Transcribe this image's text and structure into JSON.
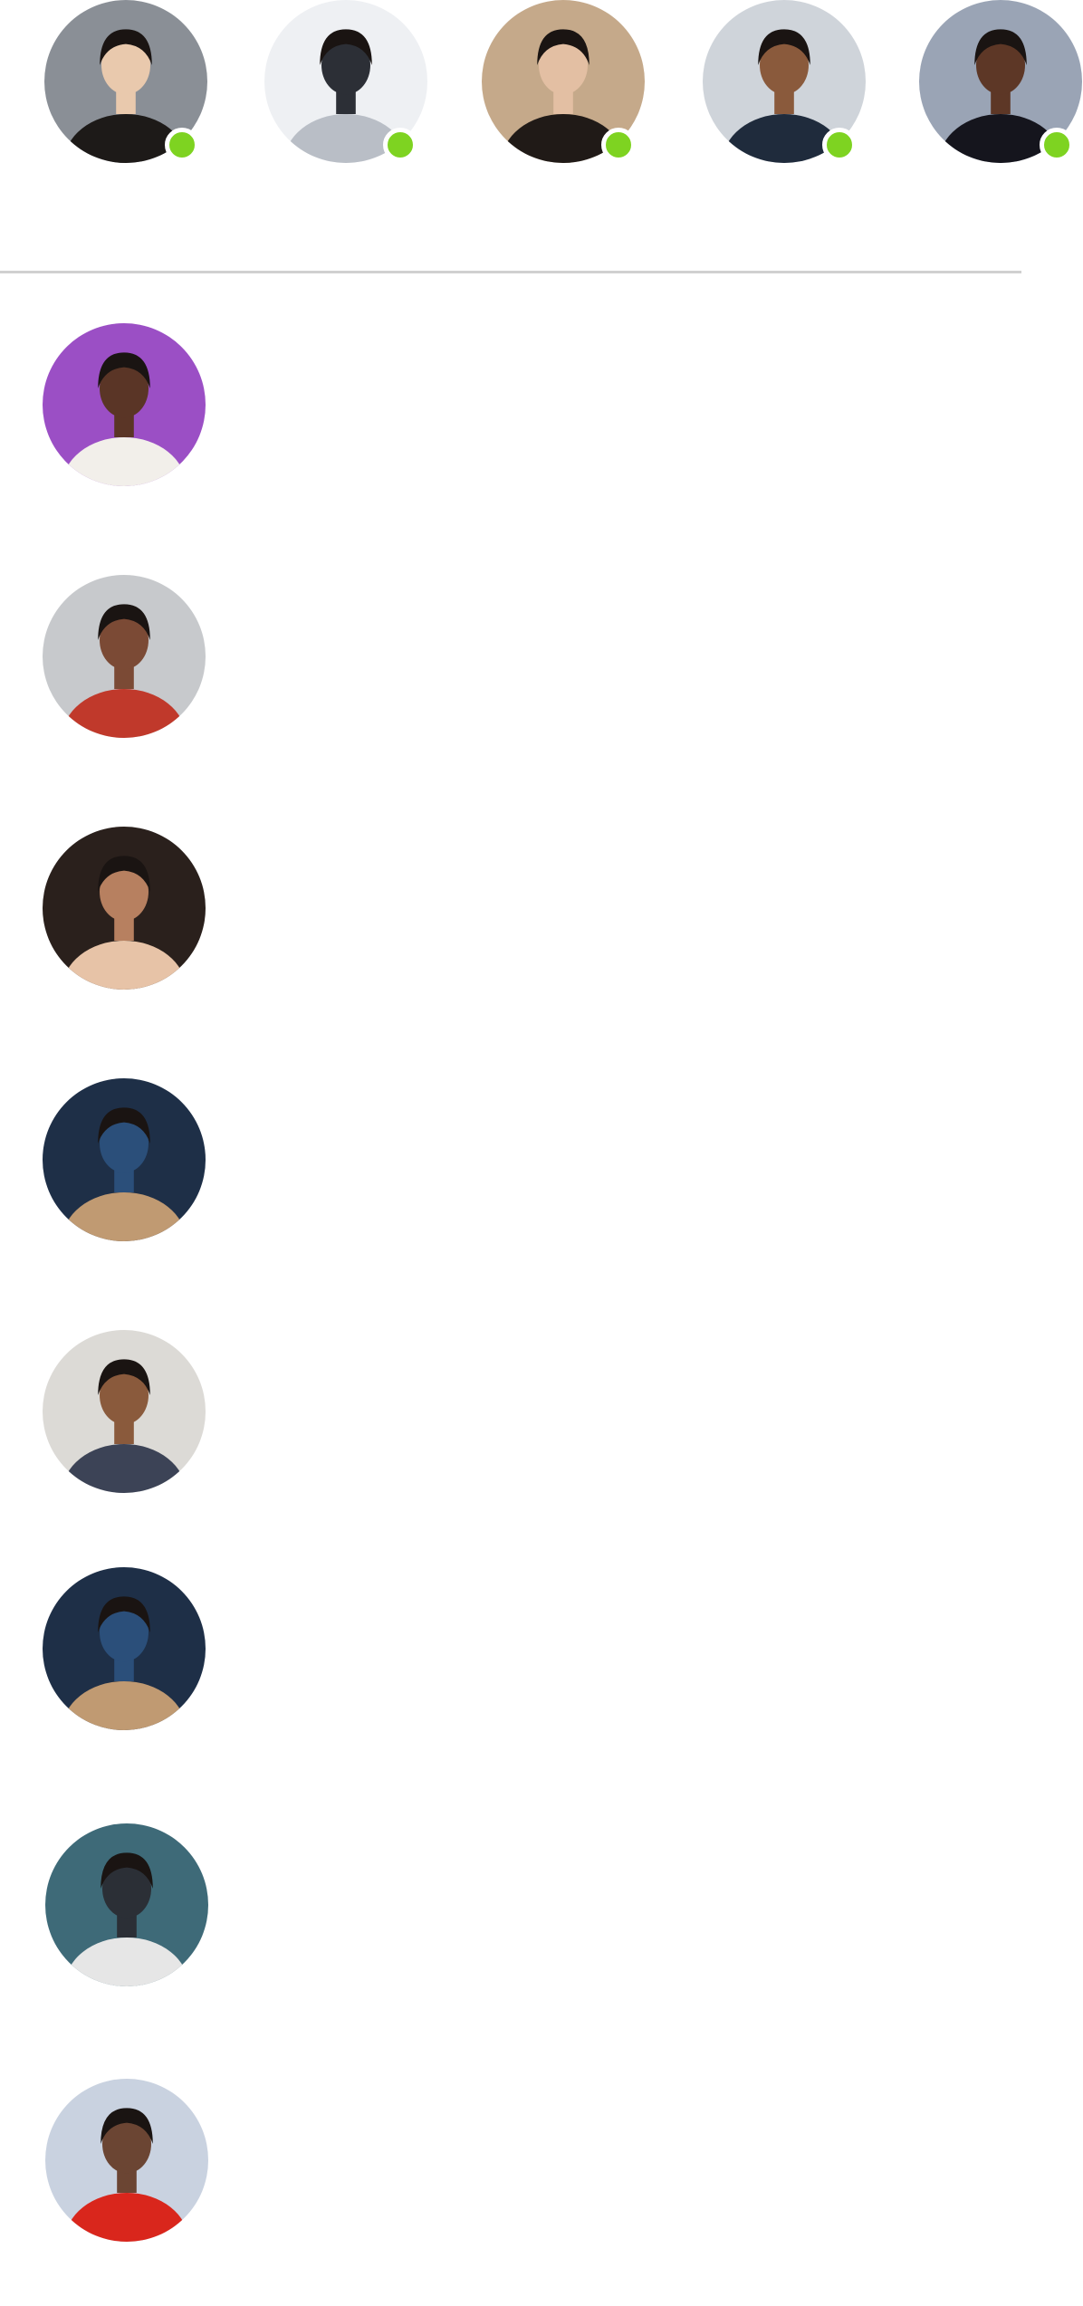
{
  "colors": {
    "online": "#7ed321",
    "divider": "#d0d0d0",
    "background": "#ffffff"
  },
  "stories": [
    {
      "icon": "avatar-photo",
      "online": true,
      "palette": [
        "#8a8f96",
        "#1d1a18",
        "#e9c9ad"
      ]
    },
    {
      "icon": "avatar-photo",
      "online": true,
      "palette": [
        "#eef0f3",
        "#b9bec6",
        "#2c2f36"
      ]
    },
    {
      "icon": "avatar-photo",
      "online": true,
      "palette": [
        "#c5a98a",
        "#201a17",
        "#e3bfa3"
      ]
    },
    {
      "icon": "avatar-photo",
      "online": true,
      "palette": [
        "#cfd4da",
        "#1f2b3c",
        "#8a5a3c"
      ]
    },
    {
      "icon": "avatar-photo",
      "online": true,
      "palette": [
        "#9aa4b5",
        "#15151d",
        "#5d3726"
      ]
    }
  ],
  "conversations": [
    {
      "icon": "avatar-photo",
      "palette": [
        "#9b4fc5",
        "#f2efea",
        "#5a3526"
      ]
    },
    {
      "icon": "avatar-photo",
      "palette": [
        "#c7c9cc",
        "#c0392b",
        "#7b4a35"
      ]
    },
    {
      "icon": "avatar-photo",
      "palette": [
        "#2a201c",
        "#e7c3a7",
        "#b78060"
      ]
    },
    {
      "icon": "avatar-photo",
      "palette": [
        "#1e2f47",
        "#c09a72",
        "#2b4f7a"
      ]
    },
    {
      "icon": "avatar-photo",
      "palette": [
        "#dcdad6",
        "#3c4356",
        "#8a5a3c"
      ]
    },
    {
      "icon": "avatar-photo",
      "palette": [
        "#1e2f47",
        "#c09a72",
        "#2b4f7a"
      ]
    },
    {
      "icon": "avatar-photo",
      "palette": [
        "#3e6a78",
        "#e6e6e6",
        "#2b2f36"
      ]
    },
    {
      "icon": "avatar-photo",
      "palette": [
        "#c9d2e0",
        "#d9261c",
        "#6b4533"
      ]
    }
  ]
}
